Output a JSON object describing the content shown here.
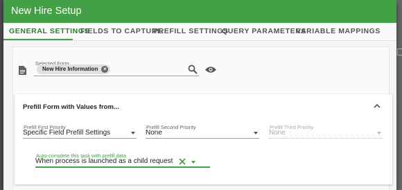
{
  "dialog": {
    "title": "New Hire Setup"
  },
  "tabs": [
    {
      "label": "GENERAL SETTINGS",
      "active": true
    },
    {
      "label": "FIELDS TO CAPTURE",
      "active": false
    },
    {
      "label": "PREFILL SETTINGS",
      "active": false
    },
    {
      "label": "QUERY PARAMETERS",
      "active": false
    },
    {
      "label": "VARIABLE MAPPINGS",
      "active": false
    }
  ],
  "selected_form": {
    "label": "Selected Form",
    "chip": "New Hire Information",
    "icons": [
      "form-icon",
      "search-icon",
      "eye-icon",
      "chip-remove-icon"
    ]
  },
  "prefill_panel": {
    "title": "Prefill Form with Values from...",
    "first": {
      "label": "Prefill First Priority",
      "value": "Specific Field Prefill Settings"
    },
    "second": {
      "label": "Prefill Second Priority",
      "value": "None"
    },
    "third": {
      "label": "Prefill Third Priority",
      "value": "None",
      "disabled": true
    },
    "auto_complete": {
      "label": "Auto-complete this task with prefill data",
      "value": "When process is launched as a child request"
    }
  },
  "colors": {
    "accent": "#43a047",
    "accent_dark": "#2e7d32"
  }
}
